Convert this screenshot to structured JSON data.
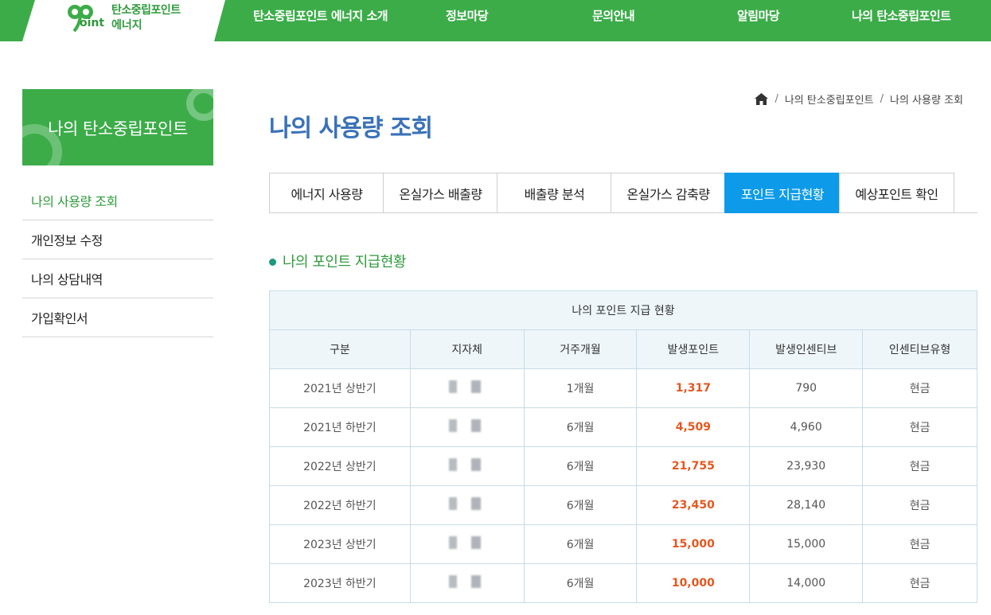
{
  "header": {
    "logo_line1": "탄소중립포인트",
    "logo_line2": "에너지",
    "logo_oint": "oint",
    "nav": [
      "탄소중립포인트 에너지 소개",
      "정보마당",
      "문의안내",
      "알림마당",
      "나의 탄소중립포인트"
    ]
  },
  "sidebar": {
    "title": "나의 탄소중립포인트",
    "items": [
      {
        "label": "나의 사용량 조회",
        "active": true
      },
      {
        "label": "개인정보 수정",
        "active": false
      },
      {
        "label": "나의 상담내역",
        "active": false
      },
      {
        "label": "가입확인서",
        "active": false
      }
    ]
  },
  "breadcrumb": [
    "나의 탄소중립포인트",
    "나의 사용량 조회"
  ],
  "page_title": "나의 사용량 조회",
  "tabs": [
    {
      "label": "에너지 사용량",
      "active": false
    },
    {
      "label": "온실가스 배출량",
      "active": false
    },
    {
      "label": "배출량 분석",
      "active": false
    },
    {
      "label": "온실가스 감축량",
      "active": false
    },
    {
      "label": "포인트 지급현황",
      "active": true
    },
    {
      "label": "예상포인트 확인",
      "active": false
    }
  ],
  "section_title": "나의 포인트 지급현황",
  "table": {
    "caption": "나의 포인트 지급 현황",
    "headers": [
      "구분",
      "지자체",
      "거주개월",
      "발생포인트",
      "발생인센티브",
      "인센티브유형"
    ],
    "rows": [
      [
        "2021년 상반기",
        "",
        "1개월",
        "1,317",
        "790",
        "현금"
      ],
      [
        "2021년 하반기",
        "",
        "6개월",
        "4,509",
        "4,960",
        "현금"
      ],
      [
        "2022년 상반기",
        "",
        "6개월",
        "21,755",
        "23,930",
        "현금"
      ],
      [
        "2022년 하반기",
        "",
        "6개월",
        "23,450",
        "28,140",
        "현금"
      ],
      [
        "2023년 상반기",
        "",
        "6개월",
        "15,000",
        "15,000",
        "현금"
      ],
      [
        "2023년 하반기",
        "",
        "6개월",
        "10,000",
        "14,000",
        "현금"
      ]
    ]
  },
  "colors": {
    "brand_green": "#3cac49",
    "active_tab": "#0d9be9",
    "title_blue": "#3a72b8",
    "point_orange": "#e4571f"
  },
  "icons": [
    "clover-logo-icon",
    "home-icon"
  ]
}
